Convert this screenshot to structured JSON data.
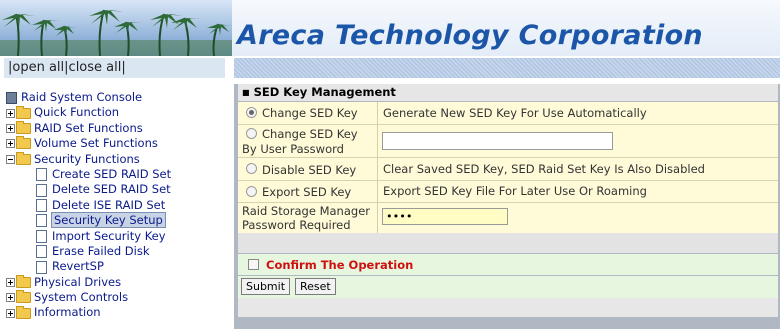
{
  "header": {
    "company": "Areca Technology Corporation"
  },
  "sidebar": {
    "open_close": {
      "sep1": "|",
      "open_all": "open all",
      "sep2": "|",
      "close_all": "close all",
      "sep3": "|"
    },
    "tree": {
      "root": "Raid System Console",
      "quick_function": "Quick Function",
      "raid_set_functions": "RAID Set Functions",
      "volume_set_functions": "Volume Set Functions",
      "security_functions": "Security Functions",
      "security_children": [
        "Create SED RAID Set",
        "Delete SED RAID Set",
        "Delete ISE RAID Set",
        "Security Key Setup",
        "Import Security Key",
        "Erase Failed Disk",
        "RevertSP"
      ],
      "physical_drives": "Physical Drives",
      "system_controls": "System Controls",
      "information": "Information"
    }
  },
  "main": {
    "section_title": "SED Key Management",
    "options": [
      {
        "label": "Change SED Key",
        "desc": "Generate New SED Key For Use Automatically",
        "selected": true
      },
      {
        "label": "Change SED Key",
        "label2": "By User Password",
        "selected": false
      },
      {
        "label": "Disable SED Key",
        "desc": "Clear Saved SED Key, SED Raid Set Key Is Also Disabled",
        "selected": false
      },
      {
        "label": "Export SED Key",
        "desc": "Export SED Key File For Later Use Or Roaming",
        "selected": false
      }
    ],
    "password": {
      "label_line1": "Raid Storage Manager",
      "label_line2": "Password Required",
      "value": "••••"
    },
    "confirm_label": "Confirm The Operation",
    "submit_label": "Submit",
    "reset_label": "Reset",
    "colors": {
      "title_blue": "#1b56a8",
      "confirm_red": "#d01010",
      "row_yellow": "#fffbd9",
      "confirm_green": "#e7f7df"
    }
  }
}
